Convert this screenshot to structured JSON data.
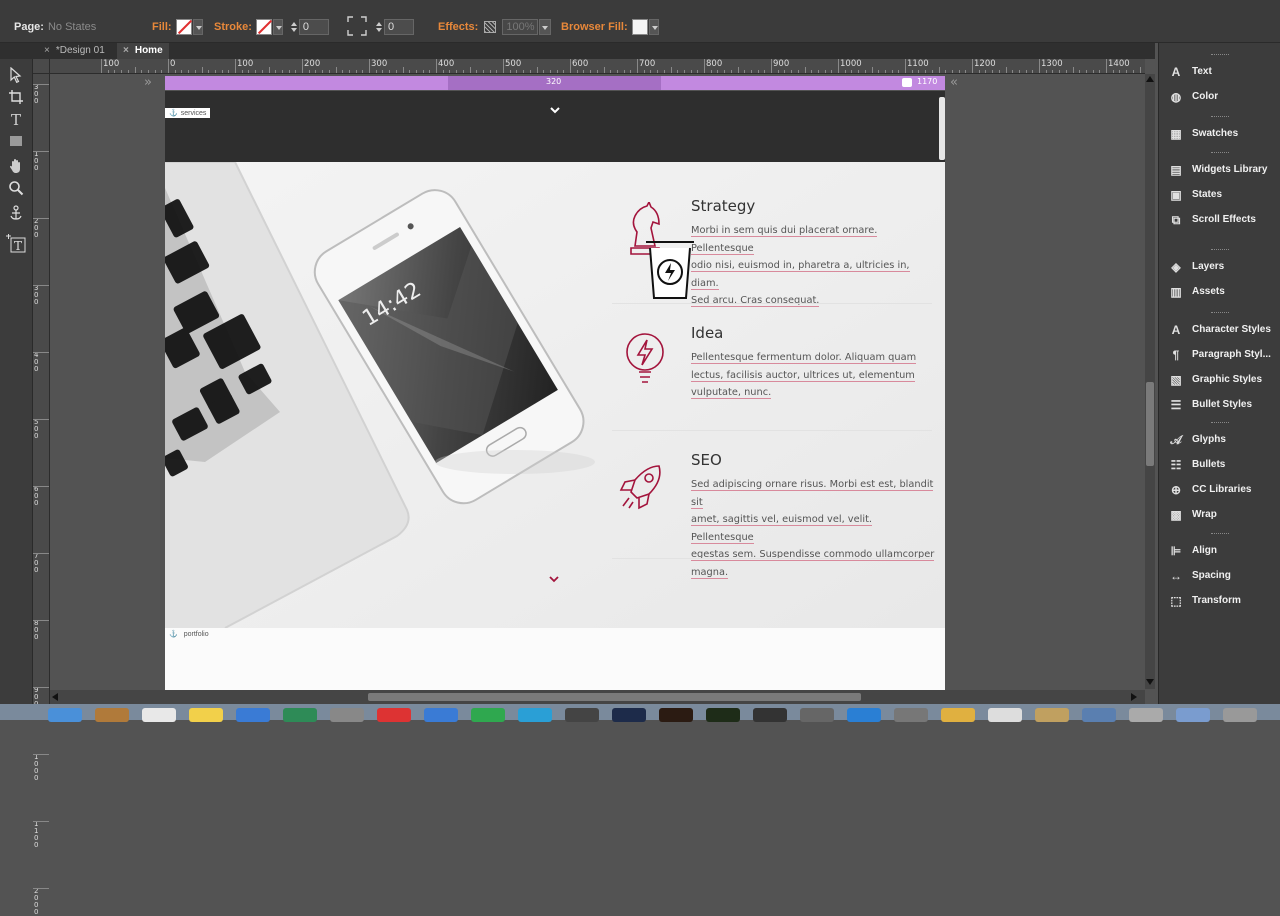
{
  "control_bar": {
    "page_label": "Page:",
    "page_value": "No States",
    "fill_label": "Fill:",
    "stroke_label": "Stroke:",
    "stroke_width": "0",
    "corner_radius": "0",
    "effects_label": "Effects:",
    "opacity": "100%",
    "browser_fill_label": "Browser Fill:"
  },
  "tabs": [
    {
      "label": "*Design 01",
      "close": "×"
    },
    {
      "label": "Home",
      "close": "×"
    }
  ],
  "ruler": {
    "labels": [
      "100",
      "0",
      "100",
      "200",
      "300",
      "400",
      "500",
      "600",
      "700",
      "800",
      "900",
      "1000",
      "1100",
      "1200",
      "1300",
      "1400"
    ],
    "vertical_labels": [
      "300",
      "100",
      "200",
      "300",
      "400",
      "500",
      "600",
      "700",
      "800",
      "900",
      "1000",
      "1100",
      "2000"
    ]
  },
  "breakpoint": {
    "left_value": "320",
    "right_value": "1170"
  },
  "anchors": {
    "top": "services",
    "bottom": "portfolio"
  },
  "features": [
    {
      "title": "Strategy",
      "lines": [
        "Morbi in sem quis dui placerat ornare. Pellentesque",
        "odio nisi, euismod in, pharetra a, ultricies in, diam.",
        "Sed arcu. Cras consequat."
      ]
    },
    {
      "title": "Idea",
      "lines": [
        "Pellentesque fermentum dolor. Aliquam quam",
        "lectus, facilisis auctor, ultrices ut, elementum",
        "vulputate, nunc."
      ]
    },
    {
      "title": "SEO",
      "lines": [
        "Sed adipiscing ornare risus. Morbi est est, blandit sit",
        "amet, sagittis vel, euismod vel, velit. Pellentesque",
        "egestas sem. Suspendisse commodo ullamcorper",
        "magna."
      ]
    }
  ],
  "phone_screen": {
    "time": "14:42"
  },
  "panels": [
    {
      "items": [
        {
          "label": "Text",
          "icon": "text-icon"
        },
        {
          "label": "Color",
          "icon": "color-icon"
        }
      ]
    },
    {
      "items": [
        {
          "label": "Swatches",
          "icon": "swatches-icon"
        }
      ]
    },
    {
      "items": [
        {
          "label": "Widgets Library",
          "icon": "widgets-icon"
        },
        {
          "label": "States",
          "icon": "states-icon"
        },
        {
          "label": "Scroll Effects",
          "icon": "scroll-effects-icon"
        }
      ]
    },
    {
      "items": [
        {
          "label": "Layers",
          "icon": "layers-icon"
        },
        {
          "label": "Assets",
          "icon": "assets-icon"
        }
      ]
    },
    {
      "items": [
        {
          "label": "Character Styles",
          "icon": "character-styles-icon"
        },
        {
          "label": "Paragraph Styl...",
          "icon": "paragraph-styles-icon"
        },
        {
          "label": "Graphic Styles",
          "icon": "graphic-styles-icon"
        },
        {
          "label": "Bullet Styles",
          "icon": "bullet-styles-icon"
        }
      ]
    },
    {
      "items": [
        {
          "label": "Glyphs",
          "icon": "glyphs-icon"
        },
        {
          "label": "Bullets",
          "icon": "bullets-icon"
        },
        {
          "label": "CC Libraries",
          "icon": "cc-libraries-icon"
        },
        {
          "label": "Wrap",
          "icon": "wrap-icon"
        }
      ]
    },
    {
      "items": [
        {
          "label": "Align",
          "icon": "align-icon"
        },
        {
          "label": "Spacing",
          "icon": "spacing-icon"
        },
        {
          "label": "Transform",
          "icon": "transform-icon"
        }
      ]
    }
  ],
  "colors": {
    "accent": "#a3143c",
    "breakpoint_bar": "#c289e0",
    "control_label": "#e8883a"
  }
}
